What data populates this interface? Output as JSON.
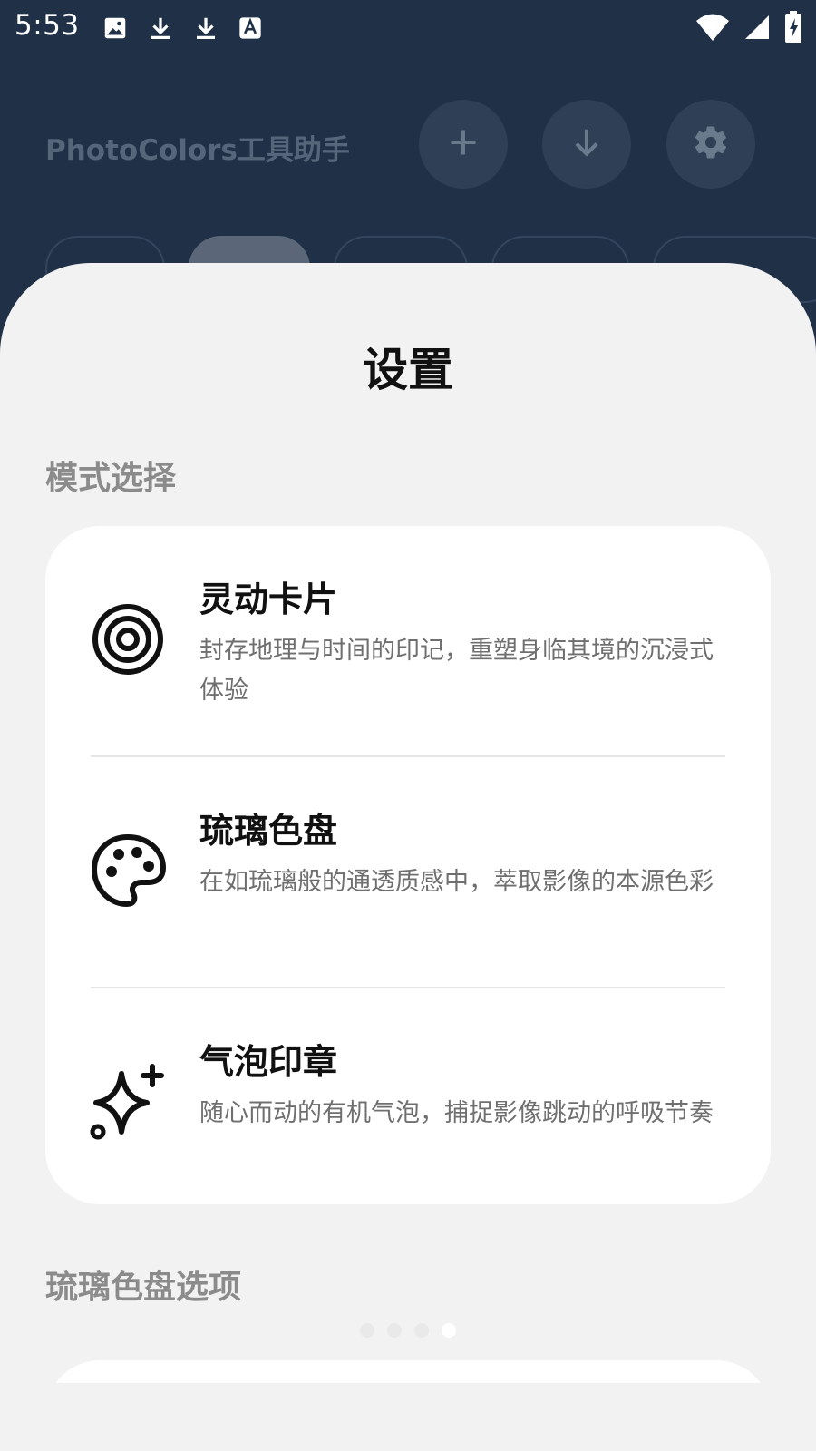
{
  "status_bar": {
    "time": "5:53",
    "left_icons": [
      "image-icon",
      "download-icon",
      "download-icon",
      "text-a-icon"
    ],
    "right_icons": [
      "wifi-icon",
      "signal-icon",
      "battery-charging-icon"
    ]
  },
  "header": {
    "title": "PhotoColors工具助手",
    "buttons": [
      {
        "icon": "plus-icon"
      },
      {
        "icon": "download-arrow-icon"
      },
      {
        "icon": "gear-icon"
      }
    ]
  },
  "sheet": {
    "title": "设置",
    "mode_section_label": "模式选择",
    "options": [
      {
        "icon": "target-icon",
        "title": "灵动卡片",
        "description": "封存地理与时间的印记，重塑身临其境的沉浸式体验"
      },
      {
        "icon": "palette-icon",
        "title": "琉璃色盘",
        "description": "在如琉璃般的通透质感中，萃取影像的本源色彩"
      },
      {
        "icon": "sparkles-icon",
        "title": "气泡印章",
        "description": "随心而动的有机气泡，捕捉影像跳动的呼吸节奏"
      }
    ],
    "palette_section_label": "琉璃色盘选项"
  },
  "pager": {
    "count": 4,
    "active_index": 3
  },
  "colors": {
    "background": "#1f3047",
    "sheet": "#f2f2f2",
    "card": "#ffffff",
    "muted_text": "#8b8b8b"
  }
}
